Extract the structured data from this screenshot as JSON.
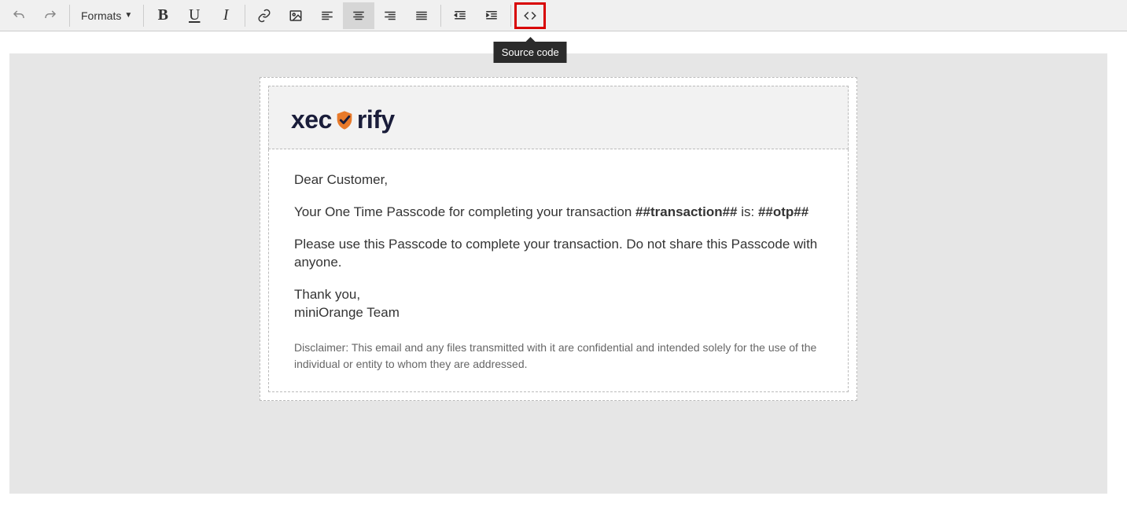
{
  "toolbar": {
    "formats_label": "Formats",
    "tooltip_source": "Source code"
  },
  "email": {
    "logo_left": "xec",
    "logo_right": "rify",
    "greeting": "Dear Customer,",
    "line1_a": "Your One Time Passcode for completing your transaction ",
    "line1_b": "##transaction##",
    "line1_c": " is: ",
    "line1_d": "##otp##",
    "line2": "Please use this Passcode to complete your transaction. Do not share this Passcode with anyone.",
    "thanks1": "Thank you,",
    "thanks2": "miniOrange Team",
    "disclaimer": "Disclaimer: This email and any files transmitted with it are confidential and intended solely for the use of the individual or entity to whom they are addressed."
  }
}
